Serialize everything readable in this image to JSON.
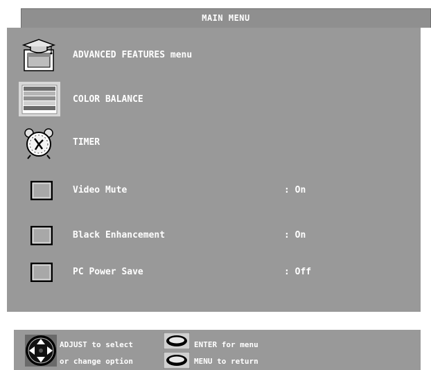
{
  "menu": {
    "title": "MAIN MENU",
    "items": [
      {
        "icon": "graduation-cap-tv-icon",
        "label": "ADVANCED FEATURES menu",
        "value": ""
      },
      {
        "icon": "color-bars-icon",
        "label": "COLOR BALANCE",
        "value": "",
        "selected": true
      },
      {
        "icon": "alarm-clock-icon",
        "label": "TIMER",
        "value": ""
      },
      {
        "icon": "checkbox-icon",
        "label": "Video Mute",
        "value": ": On"
      },
      {
        "icon": "checkbox-icon",
        "label": "Black Enhancement",
        "value": ": On"
      },
      {
        "icon": "checkbox-icon",
        "label": "PC Power Save",
        "value": ": Off"
      }
    ]
  },
  "help": {
    "adjust_line1": "ADJUST to select",
    "adjust_line2": "or change option",
    "enter_text": "ENTER for menu",
    "menu_text": "MENU  to return"
  },
  "colors": {
    "panel": "#999999",
    "title_bar": "#8f8f8f",
    "text": "#ffffff"
  }
}
